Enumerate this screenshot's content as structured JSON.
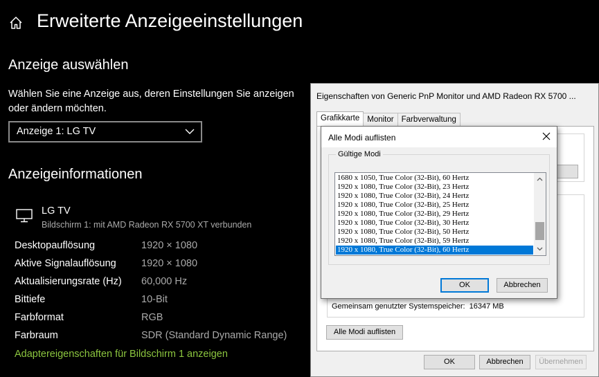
{
  "settings": {
    "title": "Erweiterte Anzeigeeinstellungen",
    "select_heading": "Anzeige auswählen",
    "select_description": "Wählen Sie eine Anzeige aus, deren Einstellungen Sie anzeigen oder ändern möchten.",
    "display_dropdown_value": "Anzeige 1: LG TV",
    "info_heading": "Anzeigeinformationen",
    "monitor_name": "LG TV",
    "monitor_subtitle": "Bildschirm 1: mit AMD Radeon RX 5700 XT verbunden",
    "info_rows": [
      {
        "label": "Desktopauflösung",
        "value": "1920 × 1080"
      },
      {
        "label": "Aktive Signalauflösung",
        "value": "1920 × 1080"
      },
      {
        "label": "Aktualisierungsrate (Hz)",
        "value": "60,000 Hz"
      },
      {
        "label": "Bittiefe",
        "value": "10-Bit"
      },
      {
        "label": "Farbformat",
        "value": "RGB"
      },
      {
        "label": "Farbraum",
        "value": "SDR (Standard Dynamic Range)"
      }
    ],
    "adapter_link": "Adaptereigenschaften für Bildschirm 1 anzeigen",
    "link_color": "#8cc63f"
  },
  "properties_dialog": {
    "title": "Eigenschaften von Generic PnP Monitor und AMD Radeon RX 5700 ...",
    "tabs": [
      "Grafikkarte",
      "Monitor",
      "Farbverwaltung"
    ],
    "active_tab": "Grafikkarte",
    "shared_memory_label": "Gemeinsam genutzter Systemspeicher:",
    "shared_memory_value": "16347 MB",
    "list_all_modes_button": "Alle Modi auflisten",
    "ok_button": "OK",
    "cancel_button": "Abbrechen",
    "apply_button": "Übernehmen"
  },
  "modes_dialog": {
    "title": "Alle Modi auflisten",
    "group_label": "Gültige Modi",
    "modes": [
      "1680 x 1050, True Color (32-Bit), 60 Hertz",
      "1920 x 1080, True Color (32-Bit), 23 Hertz",
      "1920 x 1080, True Color (32-Bit), 24 Hertz",
      "1920 x 1080, True Color (32-Bit), 25 Hertz",
      "1920 x 1080, True Color (32-Bit), 29 Hertz",
      "1920 x 1080, True Color (32-Bit), 30 Hertz",
      "1920 x 1080, True Color (32-Bit), 50 Hertz",
      "1920 x 1080, True Color (32-Bit), 59 Hertz",
      "1920 x 1080, True Color (32-Bit), 60 Hertz"
    ],
    "selected_mode": "1920 x 1080, True Color (32-Bit), 60 Hertz",
    "ok_button": "OK",
    "cancel_button": "Abbrechen",
    "selection_color": "#0078d7"
  }
}
